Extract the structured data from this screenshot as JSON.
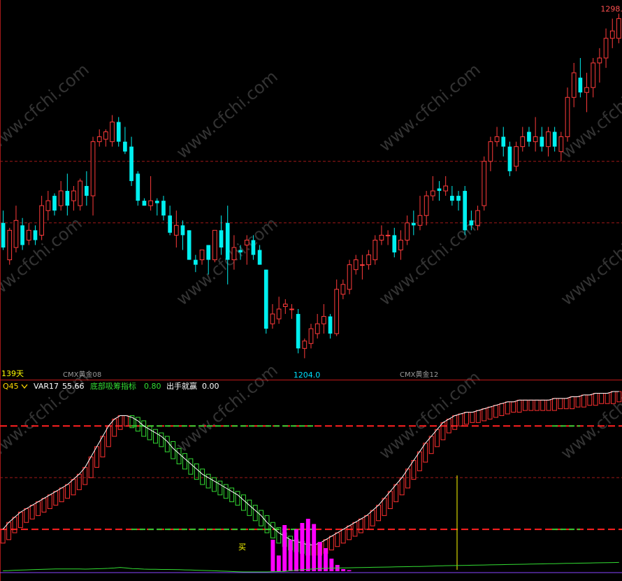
{
  "colors": {
    "up": "#ff3b3b",
    "down": "#00f0f0",
    "grid": "#a01818",
    "panel_sep": "#c01818",
    "price_label_high": "#ff5050",
    "price_label_low": "#00e0ff",
    "days_label": "#ffff00",
    "contract_label": "#9a9a9a",
    "var17": "#ffffff",
    "bottom_index": "#33dd33",
    "win": "#ffffff",
    "signal": "#ff00ff",
    "buy_label": "#ffff00",
    "yellow_line": "#ffff00",
    "watermark": "#333333"
  },
  "price_panel": {
    "days_label": "139天",
    "contract_labels": [
      "CMX黄金08",
      "CMX黄金12"
    ],
    "high_label": "1298.8",
    "low_label": "1204.0"
  },
  "indicator_panel": {
    "name": "Q45",
    "dropdown_icon": "chevron-down-icon",
    "items": [
      {
        "label": "VAR17",
        "value": "55.66"
      },
      {
        "label": "底部吸筹指标",
        "value": "0.80"
      },
      {
        "label": "出手就赢",
        "value": "0.00"
      }
    ],
    "buy_label": "买"
  },
  "watermark": "www.cfchi.com",
  "chart_data": [
    {
      "type": "candlestick",
      "title": "",
      "high_annotation": 1298.8,
      "low_annotation": 1204.0,
      "ylim": [
        1195,
        1345
      ],
      "grid_levels": [
        1280,
        1255
      ],
      "candles": [
        [
          1255,
          1245,
          1260,
          1244
        ],
        [
          1240,
          1252,
          1253,
          1238
        ],
        [
          1245,
          1256,
          1262,
          1243
        ],
        [
          1254,
          1246,
          1257,
          1244
        ],
        [
          1248,
          1252,
          1255,
          1246
        ],
        [
          1252,
          1248,
          1254,
          1246
        ],
        [
          1250,
          1262,
          1266,
          1248
        ],
        [
          1260,
          1264,
          1268,
          1256
        ],
        [
          1266,
          1260,
          1267,
          1258
        ],
        [
          1262,
          1268,
          1272,
          1260
        ],
        [
          1268,
          1262,
          1275,
          1258
        ],
        [
          1264,
          1268,
          1270,
          1260
        ],
        [
          1262,
          1272,
          1273,
          1260
        ],
        [
          1270,
          1266,
          1276,
          1262
        ],
        [
          1266,
          1288,
          1290,
          1258
        ],
        [
          1288,
          1290,
          1293,
          1286
        ],
        [
          1289,
          1292,
          1293,
          1286
        ],
        [
          1288,
          1296,
          1298.8,
          1286
        ],
        [
          1296,
          1288,
          1298,
          1286
        ],
        [
          1288,
          1284,
          1294,
          1283
        ],
        [
          1286,
          1272,
          1290,
          1270
        ],
        [
          1275,
          1264,
          1276,
          1262
        ],
        [
          1264,
          1262,
          1265,
          1262
        ],
        [
          1262,
          1264,
          1274,
          1260
        ],
        [
          1264,
          1263,
          1265,
          1258
        ],
        [
          1264,
          1258,
          1266,
          1256
        ],
        [
          1258,
          1251,
          1262,
          1250
        ],
        [
          1250,
          1254,
          1260,
          1245
        ],
        [
          1254,
          1250,
          1256,
          1244
        ],
        [
          1252,
          1240,
          1252,
          1240
        ],
        [
          1240,
          1238,
          1242,
          1235
        ],
        [
          1240,
          1244,
          1244,
          1238
        ],
        [
          1246,
          1240,
          1246,
          1234
        ],
        [
          1240,
          1252,
          1252,
          1239
        ],
        [
          1252,
          1245,
          1258,
          1242
        ],
        [
          1255,
          1240,
          1262,
          1230
        ],
        [
          1240,
          1245,
          1250,
          1236
        ],
        [
          1244,
          1243,
          1246,
          1240
        ],
        [
          1246,
          1248,
          1250,
          1238
        ],
        [
          1248,
          1242,
          1250,
          1240
        ],
        [
          1244,
          1238,
          1246,
          1238
        ],
        [
          1236,
          1212,
          1236,
          1210
        ],
        [
          1214,
          1218,
          1222,
          1212
        ],
        [
          1216,
          1220,
          1225,
          1214
        ],
        [
          1221,
          1222,
          1224,
          1218
        ],
        [
          1220,
          1220,
          1222,
          1216
        ],
        [
          1218,
          1204,
          1220,
          1202
        ],
        [
          1204,
          1207,
          1208,
          1200
        ],
        [
          1206,
          1212,
          1214,
          1204
        ],
        [
          1210,
          1214,
          1218,
          1208
        ],
        [
          1214,
          1217,
          1222,
          1210
        ],
        [
          1217,
          1210,
          1218,
          1208
        ],
        [
          1210,
          1228,
          1232,
          1209
        ],
        [
          1226,
          1230,
          1232,
          1224
        ],
        [
          1228,
          1238,
          1240,
          1226
        ],
        [
          1236,
          1240,
          1242,
          1234
        ],
        [
          1238,
          1238,
          1242,
          1232
        ],
        [
          1238,
          1242,
          1244,
          1236
        ],
        [
          1240,
          1248,
          1250,
          1238
        ],
        [
          1248,
          1250,
          1254,
          1246
        ],
        [
          1250,
          1250,
          1252,
          1246
        ],
        [
          1250,
          1243,
          1253,
          1241
        ],
        [
          1244,
          1248,
          1252,
          1240
        ],
        [
          1248,
          1255,
          1258,
          1246
        ],
        [
          1255,
          1254,
          1260,
          1250
        ],
        [
          1254,
          1258,
          1266,
          1252
        ],
        [
          1258,
          1266,
          1268,
          1254
        ],
        [
          1266,
          1268,
          1274,
          1264
        ],
        [
          1269,
          1268,
          1272,
          1264
        ],
        [
          1268,
          1270,
          1274,
          1266
        ],
        [
          1266,
          1264,
          1270,
          1262
        ],
        [
          1266,
          1264,
          1268,
          1260
        ],
        [
          1268,
          1252,
          1270,
          1250
        ],
        [
          1256,
          1254,
          1260,
          1252
        ],
        [
          1254,
          1260,
          1262,
          1252
        ],
        [
          1262,
          1280,
          1282,
          1260
        ],
        [
          1280,
          1288,
          1290,
          1276
        ],
        [
          1288,
          1290,
          1294,
          1286
        ],
        [
          1290,
          1286,
          1294,
          1282
        ],
        [
          1286,
          1276,
          1288,
          1274
        ],
        [
          1278,
          1286,
          1288,
          1276
        ],
        [
          1286,
          1290,
          1294,
          1284
        ],
        [
          1292,
          1288,
          1294,
          1286
        ],
        [
          1288,
          1290,
          1298,
          1284
        ],
        [
          1290,
          1286,
          1294,
          1284
        ],
        [
          1286,
          1292,
          1294,
          1282
        ],
        [
          1292,
          1286,
          1294,
          1284
        ],
        [
          1284,
          1290,
          1292,
          1280
        ],
        [
          1290,
          1306,
          1310,
          1288
        ],
        [
          1306,
          1316,
          1320,
          1302
        ],
        [
          1314,
          1308,
          1322,
          1306
        ],
        [
          1308,
          1310,
          1316,
          1300
        ],
        [
          1310,
          1320,
          1322,
          1306
        ],
        [
          1320,
          1322,
          1326,
          1312
        ],
        [
          1322,
          1330,
          1334,
          1318
        ],
        [
          1330,
          1333,
          1338,
          1326
        ],
        [
          1330,
          1338,
          1340,
          1328
        ]
      ]
    },
    {
      "type": "indicator",
      "title": "Q45",
      "series": [
        {
          "name": "VAR17",
          "current": 55.66
        },
        {
          "name": "底部吸筹指标",
          "current": 0.8
        },
        {
          "name": "出手就赢",
          "current": 0.0
        }
      ],
      "reference_levels": [
        80,
        50,
        20
      ],
      "ylim": [
        -10,
        100
      ],
      "oscillator": [
        20,
        24,
        27,
        30,
        32,
        34,
        36,
        38,
        40,
        42,
        44,
        46,
        49,
        52,
        56,
        62,
        68,
        74,
        80,
        84,
        86,
        86,
        85,
        83,
        80,
        78,
        76,
        74,
        71,
        67,
        64,
        61,
        58,
        55,
        52,
        50,
        48,
        46,
        44,
        42,
        40,
        37,
        34,
        31,
        28,
        24,
        21,
        18,
        16,
        14,
        13,
        12,
        11,
        11,
        12,
        14,
        16,
        18,
        20,
        22,
        24,
        26,
        28,
        31,
        34,
        38,
        42,
        46,
        50,
        55,
        60,
        65,
        70,
        74,
        78,
        82,
        84,
        86,
        87,
        88,
        88,
        89,
        90,
        91,
        92,
        93,
        94,
        94,
        95,
        95,
        95,
        95,
        95,
        95,
        96,
        96,
        96,
        97,
        97,
        98,
        98,
        99,
        99,
        99,
        100,
        100
      ],
      "signal_bars": [
        0,
        0,
        0,
        0,
        0,
        0,
        0,
        0,
        0,
        0,
        0,
        0,
        0,
        0,
        0,
        0,
        0,
        0,
        0,
        0,
        0,
        0,
        0,
        0,
        0,
        0,
        0,
        0,
        0,
        0,
        0,
        0,
        0,
        0,
        0,
        0,
        0,
        0,
        0,
        0,
        0,
        0,
        0,
        0,
        0,
        0,
        30,
        15,
        44,
        30,
        40,
        46,
        50,
        45,
        28,
        22,
        12,
        6,
        2,
        1,
        0,
        0,
        0,
        0,
        0,
        0,
        0,
        0,
        0,
        0,
        0,
        0,
        0,
        0,
        0,
        0,
        0,
        0,
        0,
        0,
        0,
        0,
        0,
        0,
        0,
        0,
        0,
        0,
        0,
        0,
        0,
        0,
        0,
        0,
        0,
        0,
        0,
        0,
        0,
        0,
        0,
        0,
        0,
        0,
        0,
        0
      ],
      "bottom_line": [
        1,
        1.2,
        1.5,
        1.6,
        1.8,
        2,
        2.2,
        2.4,
        2.5,
        2.6,
        2.6,
        2.7,
        2.6,
        2.6,
        2.5,
        2.6,
        2.8,
        3,
        3.2,
        3.5,
        4,
        3.5,
        3,
        2.8,
        2.5,
        2.4,
        2.3,
        2.2,
        2.2,
        2.1,
        2,
        1.8,
        1.7,
        1.5,
        1.3,
        1.2,
        1,
        0.8,
        0.6,
        0.4,
        0.2,
        0,
        0,
        0,
        0,
        0,
        0.1,
        0.3,
        0.5,
        1,
        1.5,
        2,
        2.3,
        2.6,
        3,
        3.2,
        3.4,
        3.5,
        3.6,
        3.7,
        3.8,
        3.9,
        4,
        4.1,
        4.2,
        4.3,
        4.4,
        4.5,
        4.6,
        4.7,
        4.8,
        4.9,
        5,
        5.2,
        5.4,
        5.5,
        5.6,
        5.7,
        5.8,
        5.9,
        6,
        6.1,
        6.2,
        6.3,
        6.4,
        6.5,
        6.6,
        6.7,
        6.8,
        6.9,
        7,
        7.1,
        7.2,
        7.3,
        7.4,
        7.5,
        7.6,
        7.7,
        7.8,
        7.9,
        8,
        8.1,
        8.2,
        8.3,
        8.4,
        8.5
      ],
      "buy_marker": "买"
    }
  ]
}
